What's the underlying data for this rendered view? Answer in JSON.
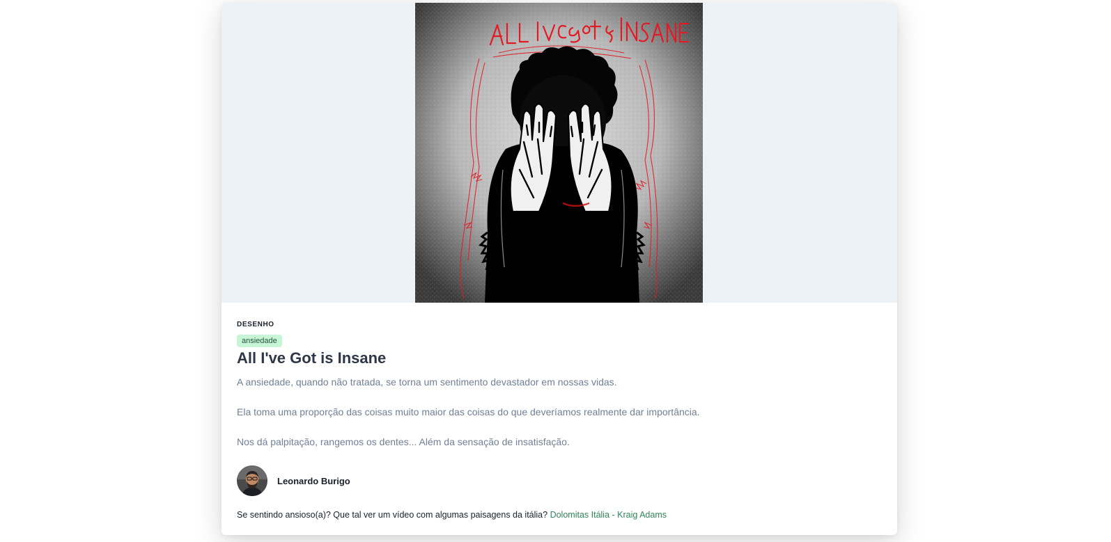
{
  "article": {
    "image_alt": "ALL I'VE Got is INSANE",
    "category": "DESENHO",
    "tag": "ansiedade",
    "title": "All I've Got is Insane",
    "paragraphs": [
      "A ansiedade, quando não tratada, se torna um sentimento devastador em nossas vidas.",
      "Ela toma uma proporção das coisas muito maior das coisas do que deveríamos realmente dar importância.",
      "Nos dá palpitação, rangemos os dentes... Além da sensação de insatisfação."
    ],
    "author": {
      "name": "Leonardo Burigo",
      "avatar_icon": "person-avatar"
    },
    "footer": {
      "text": "Se sentindo ansioso(a)? Que tal ver um vídeo com algumas paisagens da itália?",
      "link_label": "Dolomitas Itália - Kraig Adams"
    }
  },
  "colors": {
    "hero_background": "#edf2f7",
    "title": "#2d3748",
    "body_text": "#718096",
    "tag_background": "#c6f6d5",
    "tag_text": "#22543d",
    "link": "#2f855a",
    "art_red": "#e01b24"
  }
}
